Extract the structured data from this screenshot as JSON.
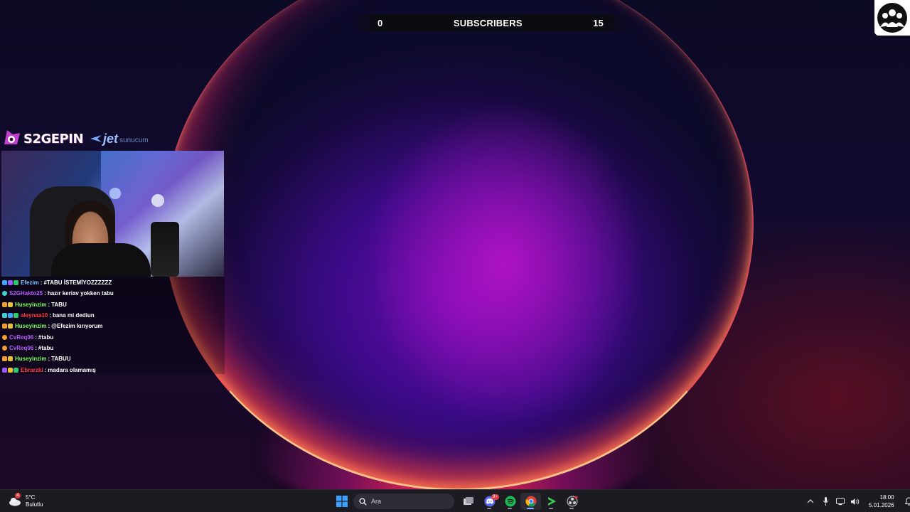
{
  "subscribers": {
    "current": "0",
    "label": "SUBSCRIBERS",
    "goal": "15"
  },
  "overlay": {
    "brand_name": "S2GEPIN",
    "sponsor_main": "jet",
    "sponsor_sub": "sunucum"
  },
  "chat": [
    {
      "user": "Efezim",
      "user_color": "#7ec8ff",
      "message": "#TABU İSTEMİYOZZZZZZ",
      "badges": [
        "#3ea6ff",
        "#9b59ff",
        "#2ecc71"
      ]
    },
    {
      "user": "S2GHakto25",
      "user_color": "#b45cff",
      "message": "hazır keriav yokken tabu",
      "badges": [
        "#3ecfcf"
      ]
    },
    {
      "user": "Huseyinzim",
      "user_color": "#7cff5a",
      "message": "TABU",
      "badges": [
        "#f0a030",
        "#e8c040"
      ]
    },
    {
      "user": "aleynaa10",
      "user_color": "#ff3b3b",
      "message": "bana mi dediun",
      "badges": [
        "#3ecfcf",
        "#3ea6ff",
        "#2ecc71"
      ]
    },
    {
      "user": "Huseyinzim",
      "user_color": "#7cff5a",
      "message": "@Efezim kırıyorum",
      "badges": [
        "#f0a030",
        "#e8c040"
      ]
    },
    {
      "user": "CvReq06",
      "user_color": "#b45cff",
      "message": "#tabu",
      "badges": [
        "#f0a030"
      ]
    },
    {
      "user": "CvReq06",
      "user_color": "#b45cff",
      "message": "#tabu",
      "badges": [
        "#f0a030"
      ]
    },
    {
      "user": "Huseyinzim",
      "user_color": "#7cff5a",
      "message": "TABUU",
      "badges": [
        "#f0a030",
        "#e8c040"
      ]
    },
    {
      "user": "Ebrarzki",
      "user_color": "#ff3b3b",
      "message": "madara olamamış",
      "badges": [
        "#9b59ff",
        "#f0c030",
        "#2ecc71"
      ]
    }
  ],
  "taskbar": {
    "weather": {
      "temp": "5°C",
      "condition": "Bulutlu",
      "badge": "4"
    },
    "search_placeholder": "Ara",
    "apps": [
      {
        "name": "task-view",
        "active": false
      },
      {
        "name": "discord",
        "active": false,
        "badge": "9+"
      },
      {
        "name": "spotify",
        "active": false
      },
      {
        "name": "chrome",
        "active": true
      },
      {
        "name": "media-player",
        "active": false
      },
      {
        "name": "obs",
        "active": false
      }
    ],
    "clock": {
      "time": "18:00",
      "date": "5.01.2026"
    }
  },
  "colors": {
    "taskbar_bg": "#1c1b22",
    "accent": "#7fb2ff",
    "orb_purple": "#6a0ab0",
    "orb_rim": "#ff6a3c"
  }
}
